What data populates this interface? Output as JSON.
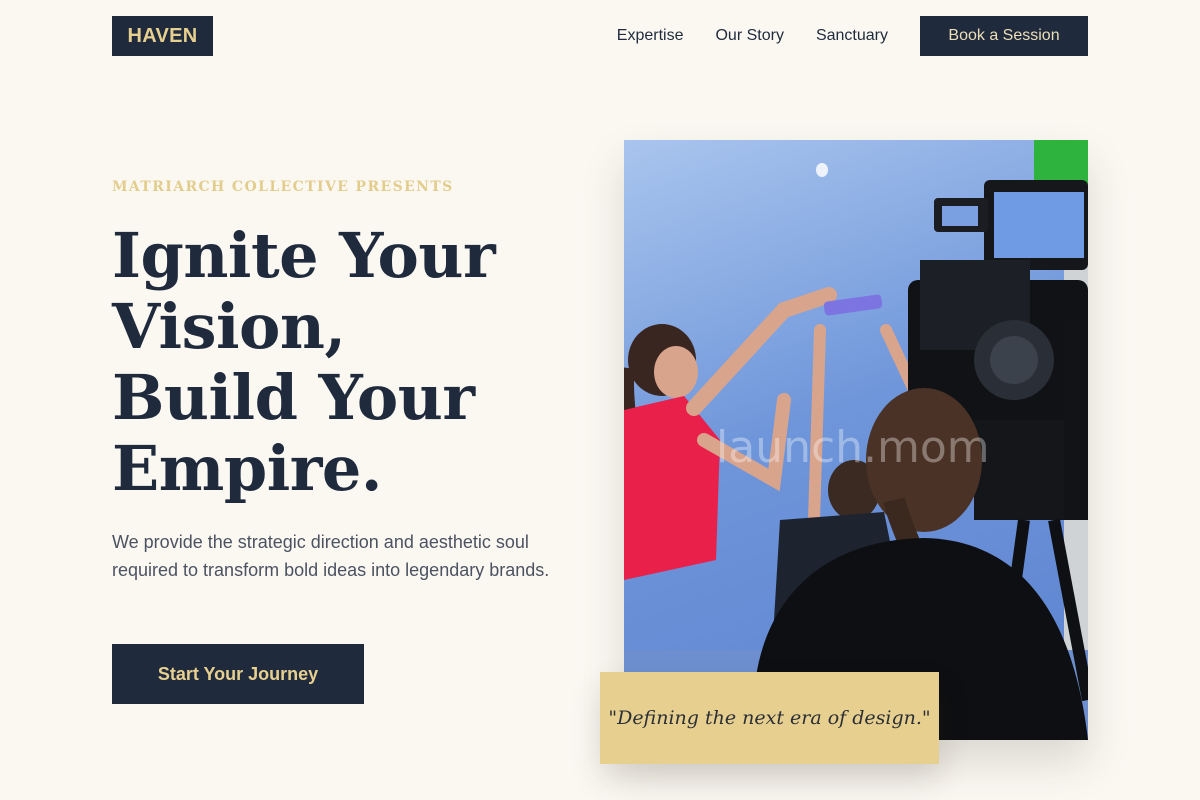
{
  "nav": {
    "logo": "HAVEN",
    "links": [
      "Expertise",
      "Our Story",
      "Sanctuary"
    ],
    "cta": "Book a Session"
  },
  "hero": {
    "eyebrow": "MATRIARCH COLLECTIVE PRESENTS",
    "headline_lines": [
      "Ignite Your",
      "Vision,",
      "Build Your",
      "Empire."
    ],
    "lede": "We provide the strategic direction and aesthetic soul required to transform bold ideas into legendary brands.",
    "cta": "Start Your Journey"
  },
  "image": {
    "watermark": "launch.mom"
  },
  "quote": "\"Defining the next era of design.\"",
  "colors": {
    "background": "#fbf8f2",
    "navy": "#1f2a3d",
    "gold": "#e7d08f",
    "eyebrow_gold": "#e3cd8d"
  }
}
